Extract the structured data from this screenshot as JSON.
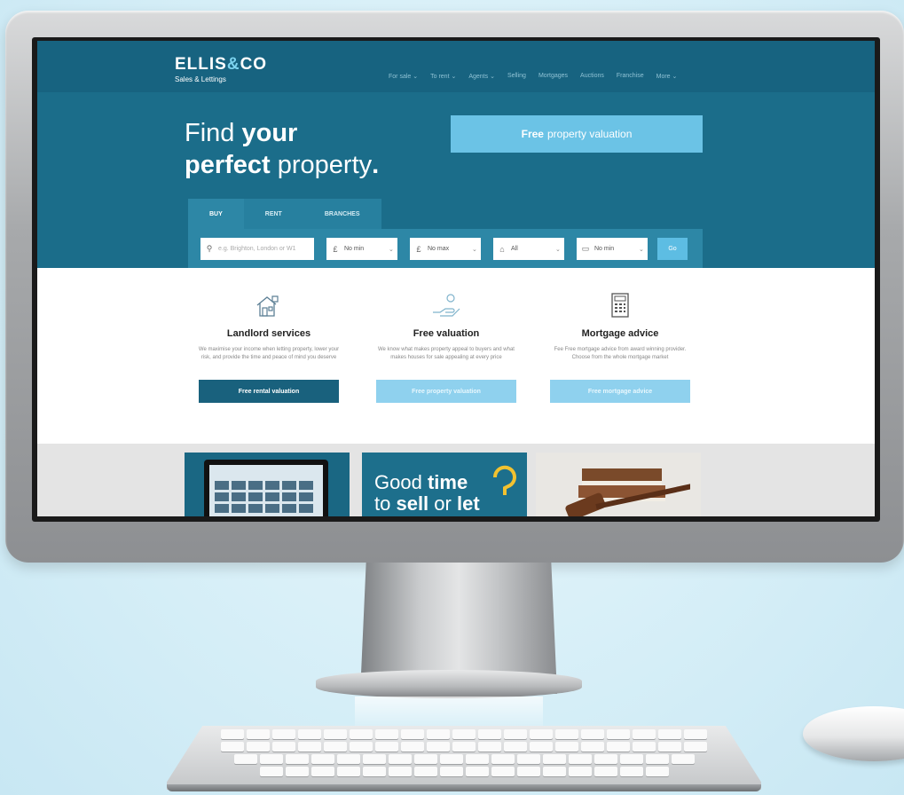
{
  "site": {
    "logo_main": "ELLIS",
    "logo_amp": "&",
    "logo_co": "CO",
    "logo_sub": "Sales & Lettings"
  },
  "nav": {
    "items": [
      "For sale ⌄",
      "To rent ⌄",
      "Agents ⌄",
      "Selling",
      "Mortgages",
      "Auctions",
      "Franchise",
      "More ⌄"
    ]
  },
  "hero": {
    "line1_a": "Find ",
    "line1_b": "your",
    "line2_a": "perfect",
    "line2_b": " property",
    "line2_c": ".",
    "valuation_bold": "Free",
    "valuation_rest": "property valuation"
  },
  "search": {
    "tabs": [
      "BUY",
      "RENT",
      "BRANCHES"
    ],
    "location_placeholder": "e.g. Brighton, London or W1",
    "min_price": "No min",
    "max_price": "No max",
    "property_type": "All",
    "bedrooms": "No min",
    "go_label": "Go"
  },
  "services": [
    {
      "title": "Landlord services",
      "desc": "We maximise your income when letting property, lower your risk, and provide the time and peace of mind you deserve",
      "button": "Free rental valuation"
    },
    {
      "title": "Free valuation",
      "desc": "We know what makes property appeal to buyers and what makes houses for sale appealing at every price",
      "button": "Free property valuation"
    },
    {
      "title": "Mortgage advice",
      "desc": "Fee Free mortgage advice from award winning provider. Choose from the whole mortgage market",
      "button": "Free mortgage advice"
    }
  ],
  "promo": {
    "good": "Good ",
    "time": "time",
    "line2_a": "to ",
    "sell": "sell",
    "or": " or ",
    "let": "let"
  },
  "colors": {
    "hero_bg": "#1b6d8a",
    "nav_bg": "#176380",
    "accent": "#6bc3e6",
    "dark_button": "#19617d",
    "promo_yellow": "#f2c230"
  }
}
